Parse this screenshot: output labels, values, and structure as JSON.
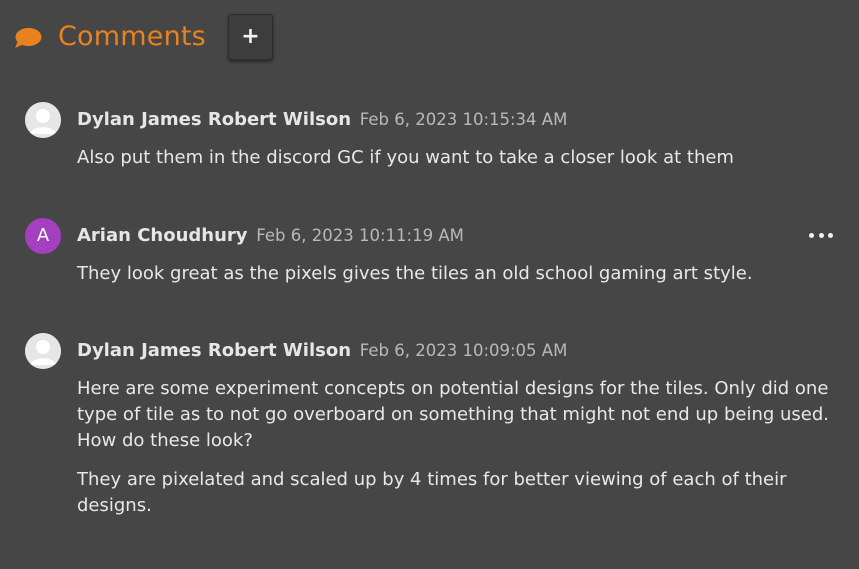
{
  "header": {
    "title": "Comments",
    "icon": "speech-bubble-icon",
    "accent_color": "#e8821f",
    "add_button_label": "+"
  },
  "comments": [
    {
      "author": "Dylan James Robert Wilson",
      "timestamp": "Feb 6, 2023 10:15:34 AM",
      "avatar": "default-user-avatar",
      "paragraphs": [
        "Also put them in the discord GC if you want to take a closer look at them"
      ]
    },
    {
      "author": "Arian Choudhury",
      "timestamp": "Feb 6, 2023 10:11:19 AM",
      "avatar_letter": "A",
      "avatar_color": "#a43fc0",
      "paragraphs": [
        "They look great as the pixels gives the tiles an old school gaming art style."
      ]
    },
    {
      "author": "Dylan James Robert Wilson",
      "timestamp": "Feb 6, 2023 10:09:05 AM",
      "avatar": "default-user-avatar",
      "paragraphs": [
        "Here are some experiment concepts on potential designs for the tiles. Only did one type of tile as to not go overboard on something that might not end up being used. How do these look?",
        "They are pixelated and scaled up by 4 times for better viewing of each of their designs."
      ]
    }
  ]
}
